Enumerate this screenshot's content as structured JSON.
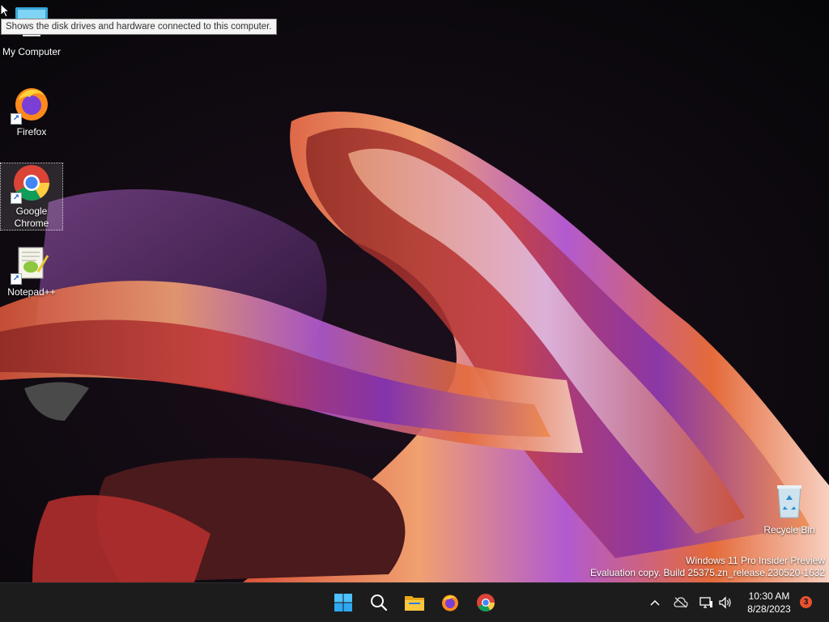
{
  "desktop": {
    "icons": [
      {
        "label": "My Computer",
        "tooltip": "Shows the disk drives and hardware connected to this computer."
      },
      {
        "label": "Firefox"
      },
      {
        "label": "Google Chrome"
      },
      {
        "label": "Notepad++"
      },
      {
        "label": "Recycle Bin"
      }
    ],
    "watermark": {
      "line1": "Windows 11 Pro Insider Preview",
      "line2": "Evaluation copy. Build 25375.zn_release.230520-1632"
    }
  },
  "taskbar": {
    "pinned": [
      {
        "icon": "windows-start-icon"
      },
      {
        "icon": "search-icon"
      },
      {
        "icon": "file-explorer-icon"
      },
      {
        "icon": "firefox-icon"
      },
      {
        "icon": "chrome-icon"
      }
    ],
    "tray": {
      "time": "10:30 AM",
      "date": "8/28/2023",
      "notification_count": "3"
    }
  }
}
